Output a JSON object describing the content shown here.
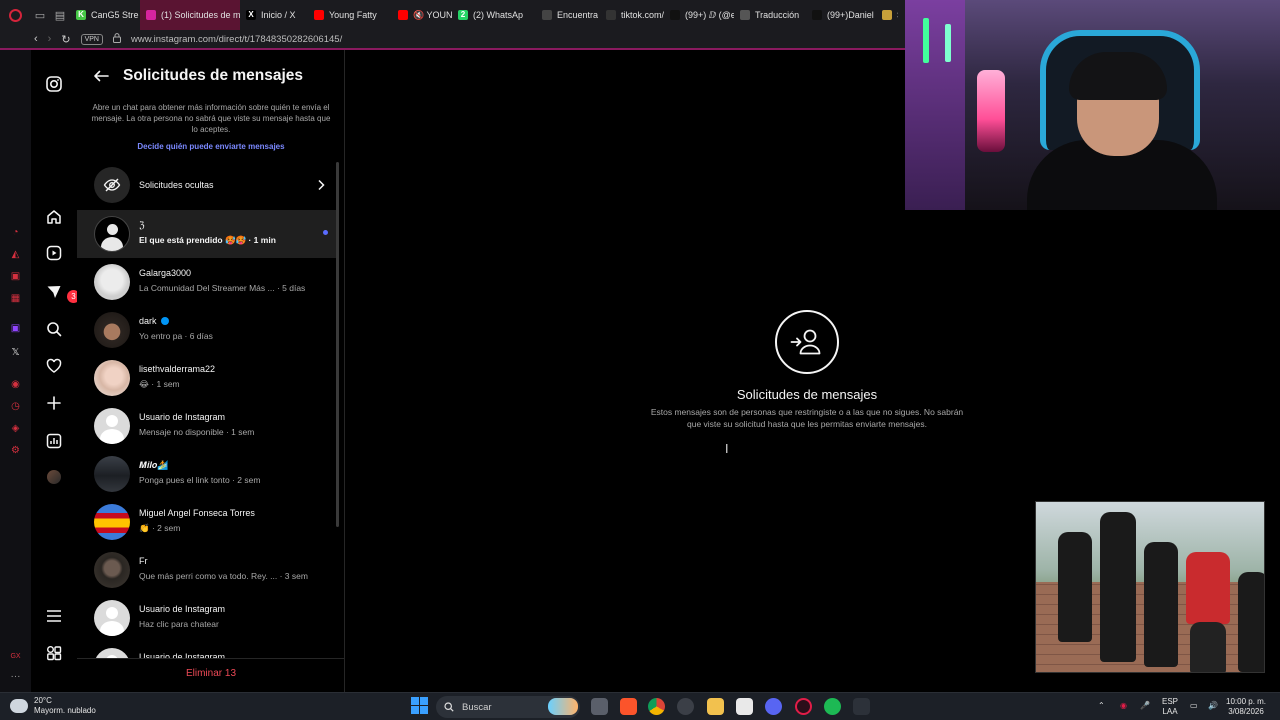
{
  "browser": {
    "tabs": [
      {
        "label": "CanG5 Stre",
        "fav_color": "#46c846",
        "fav_glyph": "K",
        "active": false
      },
      {
        "label": "(1) Solicitudes de me",
        "fav_color": "#d6249f",
        "fav_glyph": "",
        "active": true
      },
      {
        "label": "Inicio / X",
        "fav_color": "#000000",
        "fav_glyph": "X",
        "active": false
      },
      {
        "label": "Young Fatty",
        "fav_color": "#ff0000",
        "fav_glyph": "",
        "active": false
      },
      {
        "label": "🔇 YOUNG",
        "fav_color": "#ff0000",
        "fav_glyph": "",
        "active": false
      },
      {
        "label": "(2) WhatsAp",
        "fav_color": "#25d366",
        "fav_glyph": "2",
        "active": false
      },
      {
        "label": "Encuentra",
        "fav_color": "#444444",
        "fav_glyph": "",
        "active": false
      },
      {
        "label": "tiktok.com/",
        "fav_color": "#333333",
        "fav_glyph": "",
        "active": false
      },
      {
        "label": "(99+) ⅅ (@e",
        "fav_color": "#111111",
        "fav_glyph": "",
        "active": false
      },
      {
        "label": "Traducción",
        "fav_color": "#555555",
        "fav_glyph": "",
        "active": false
      },
      {
        "label": "(99+)Daniel",
        "fav_color": "#111111",
        "fav_glyph": "",
        "active": false
      },
      {
        "label": "Sa",
        "fav_color": "#c8a03a",
        "fav_glyph": "",
        "active": false
      }
    ],
    "vpn_label": "VPN",
    "url": "www.instagram.com/direct/t/17848350282606145/"
  },
  "nav": {
    "notification_count": "3"
  },
  "requests": {
    "title": "Solicitudes de mensajes",
    "description": "Abre un chat para obtener más información sobre quién te envía el mensaje. La otra persona no sabrá que viste su mensaje hasta que lo aceptes.",
    "settings_link": "Decide quién puede enviarte mensajes",
    "hidden_label": "Solicitudes ocultas",
    "items": [
      {
        "name": "ℨ",
        "preview": "El que está prendido 🥵🥵 · 1 min",
        "avatar": "dark",
        "unread": true,
        "verified": false
      },
      {
        "name": "Galarga3000",
        "preview": "La Comunidad Del Streamer Más ... · 5 días",
        "avatar": "photo1",
        "unread": false,
        "verified": false
      },
      {
        "name": "dark",
        "preview": "Yo entro pa · 6 días",
        "avatar": "photo2",
        "unread": false,
        "verified": true
      },
      {
        "name": "lisethvalderrama22",
        "preview": "😂 · 1 sem",
        "avatar": "photo3",
        "unread": false,
        "verified": false
      },
      {
        "name": "Usuario de Instagram",
        "preview": "Mensaje no disponible · 1 sem",
        "avatar": "default",
        "unread": false,
        "verified": false
      },
      {
        "name": "𝑴𝒊𝒍𝒐🏄",
        "preview": "Ponga pues el link tonto · 2 sem",
        "avatar": "photo4",
        "unread": false,
        "verified": false
      },
      {
        "name": "Miguel Angel Fonseca Torres",
        "preview": "👏 · 2 sem",
        "avatar": "flag",
        "unread": false,
        "verified": false
      },
      {
        "name": "Fr",
        "preview": "Que más perri como va todo. Rey. ... · 3 sem",
        "avatar": "photo5",
        "unread": false,
        "verified": false
      },
      {
        "name": "Usuario de Instagram",
        "preview": "Haz clic para chatear",
        "avatar": "default",
        "unread": false,
        "verified": false
      },
      {
        "name": "Usuario de Instagram",
        "preview": "",
        "avatar": "default",
        "unread": false,
        "verified": false
      }
    ],
    "delete_label": "Eliminar 13"
  },
  "main": {
    "empty_title": "Solicitudes de mensajes",
    "empty_description": "Estos mensajes son de personas que restringiste o a las que no sigues. No sabrán que viste su solicitud hasta que les permitas enviarte mensajes."
  },
  "taskbar": {
    "weather_temp": "20°C",
    "weather_desc": "Mayorm. nublado",
    "search_label": "Buscar",
    "lang_top": "ESP",
    "lang_bottom": "LAA",
    "time": "10:00 p. m.",
    "date": "3/08/2026"
  },
  "colors": {
    "accent_link": "#7b89ff",
    "delete_red": "#ed4956",
    "unread_dot": "#5a6cff",
    "active_tab": "#5a1432"
  }
}
